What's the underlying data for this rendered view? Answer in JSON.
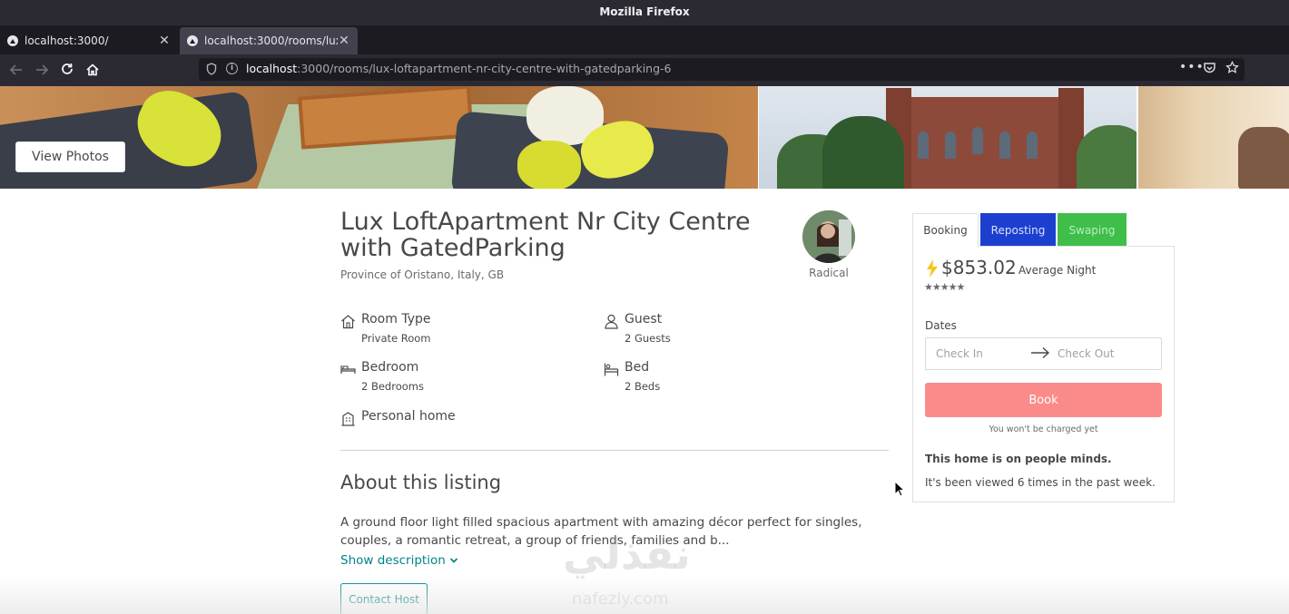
{
  "browser": {
    "window_title": "Mozilla Firefox",
    "tabs": [
      {
        "title": "localhost:3000/",
        "close": "✕"
      },
      {
        "title": "localhost:3000/rooms/lux-loftapartment-nr-city-centre-with-gatedparking-6",
        "close": "✕"
      }
    ],
    "new_tab": "+",
    "url_host": "localhost",
    "url_rest": ":3000/rooms/lux-loftapartment-nr-city-centre-with-gatedparking-6",
    "icons": [
      "back-icon",
      "forward-icon",
      "reload-icon",
      "home-icon",
      "shield-icon",
      "info-icon",
      "page-actions-icon",
      "pocket-icon",
      "bookmark-star-icon"
    ]
  },
  "hero": {
    "view_photos_label": "View Photos"
  },
  "listing": {
    "title": "Lux LoftApartment Nr City Centre with GatedParking",
    "location": "Province of Oristano, Italy, GB",
    "host_name": "Radical",
    "features": {
      "room_type": {
        "label": "Room Type",
        "value": "Private Room"
      },
      "guest": {
        "label": "Guest",
        "value": "2 Guests"
      },
      "bedroom": {
        "label": "Bedroom",
        "value": "2 Bedrooms"
      },
      "bed": {
        "label": "Bed",
        "value": "2 Beds"
      },
      "personal_home": {
        "label": "Personal home"
      }
    },
    "about_title": "About this listing",
    "about_text": "A ground floor light filled spacious apartment with amazing décor perfect for singles, couples, a romantic retreat, a group of friends, families and b...",
    "show_description": "Show description",
    "contact_host": "Contact Host"
  },
  "booking": {
    "tabs": {
      "booking": "Booking",
      "reposting": "Reposting",
      "swaping": "Swaping"
    },
    "price": "$853.02",
    "price_suffix": "Average Night",
    "stars": "★★★★★",
    "rating_stars": 5,
    "dates_label": "Dates",
    "check_in_placeholder": "Check In",
    "check_out_placeholder": "Check Out",
    "book_button": "Book",
    "no_charge_note": "You won't be charged yet",
    "minds_note": "This home is on people minds.",
    "viewed_note": "It's been viewed 6 times in the past week.",
    "colors": {
      "reposting": "#1d3fd0",
      "swaping": "#3fbf4a",
      "book": "#fb8b8b",
      "accent": "#008489"
    }
  },
  "watermark": {
    "text": "نفذلي",
    "sub": "nafezly.com"
  }
}
